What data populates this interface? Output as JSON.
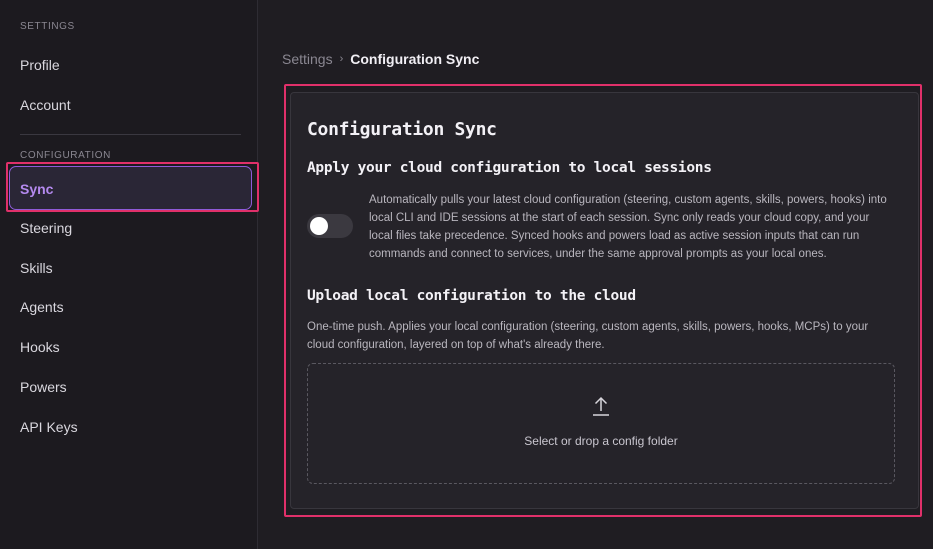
{
  "sidebar": {
    "settings_section": "SETTINGS",
    "configuration_section": "CONFIGURATION",
    "items": [
      {
        "label": "Profile"
      },
      {
        "label": "Account"
      },
      {
        "label": "Sync"
      },
      {
        "label": "Steering"
      },
      {
        "label": "Skills"
      },
      {
        "label": "Agents"
      },
      {
        "label": "Hooks"
      },
      {
        "label": "Powers"
      },
      {
        "label": "API Keys"
      }
    ],
    "active_item": "Sync"
  },
  "breadcrumb": {
    "parent": "Settings",
    "separator": "›",
    "current": "Configuration Sync"
  },
  "card": {
    "title": "Configuration Sync",
    "apply": {
      "heading": "Apply your cloud configuration to local sessions",
      "toggle_on": false,
      "description": "Automatically pulls your latest cloud configuration (steering, custom agents, skills, powers, hooks) into local CLI and IDE sessions at the start of each session. Sync only reads your cloud copy, and your local files take precedence. Synced hooks and powers load as active session inputs that can run commands and connect to services, under the same approval prompts as your local ones."
    },
    "upload": {
      "heading": "Upload local configuration to the cloud",
      "description": "One-time push. Applies your local configuration (steering, custom agents, skills, powers, hooks, MCPs) to your cloud configuration, layered on top of what's already there.",
      "dropzone_label": "Select or drop a config folder",
      "dropzone_icon": "upload-icon"
    }
  },
  "colors": {
    "highlight": "#e0306a",
    "accent": "#b58af0",
    "background": "#1f1d22"
  }
}
